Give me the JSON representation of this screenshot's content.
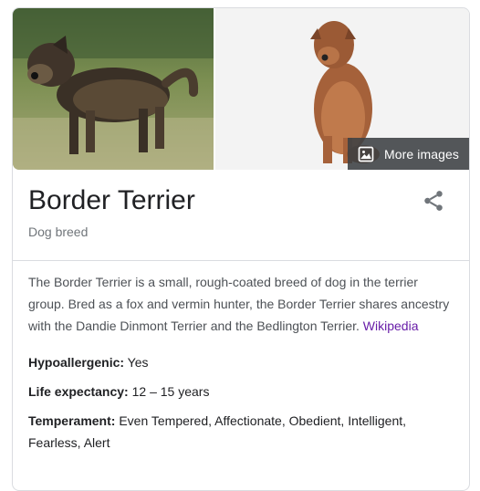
{
  "knowledge_panel": {
    "title": "Border Terrier",
    "subtitle": "Dog breed",
    "more_images_label": "More images",
    "share_icon": "share-icon",
    "description": "The Border Terrier is a small, rough-coated breed of dog in the terrier group. Bred as a fox and vermin hunter, the Border Terrier shares ancestry with the Dandie Dinmont Terrier and the Bedlington Terrier.",
    "source_link": "Wikipedia",
    "facts": [
      {
        "label": "Hypoallergenic:",
        "value": "Yes"
      },
      {
        "label": "Life expectancy:",
        "value": "12 – 15 years"
      },
      {
        "label": "Temperament:",
        "value": "Even Tempered, Affectionate, Obedient, Intelligent, Fearless, Alert"
      }
    ]
  },
  "colors": {
    "link_visited": "#681da8",
    "border": "#dadce0",
    "secondary_text": "#70757a"
  }
}
